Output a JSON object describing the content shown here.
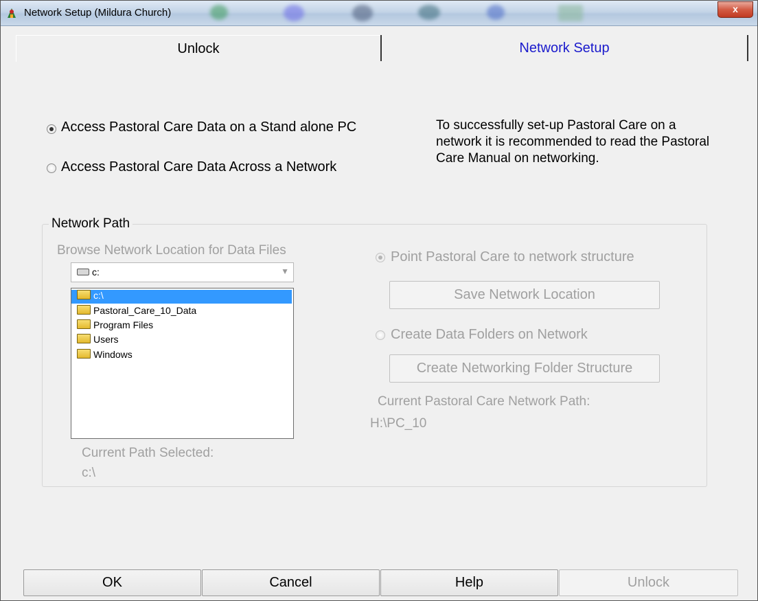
{
  "window": {
    "title": "Network Setup (Mildura Church)",
    "close_label": "x"
  },
  "tabs": [
    {
      "label": "Unlock"
    },
    {
      "label": "Network Setup"
    }
  ],
  "access_options": {
    "standalone_label": "Access Pastoral Care Data on a Stand alone PC",
    "network_label": "Access Pastoral Care Data Across a Network",
    "selected": "standalone"
  },
  "info_text": "To successfully set-up Pastoral Care on a network it is recommended to read the Pastoral Care Manual on networking.",
  "network_path": {
    "legend": "Network Path",
    "browse_label": "Browse Network Location for Data Files",
    "drive_value": "c:",
    "folders": [
      "c:\\",
      "Pastoral_Care_10_Data",
      "Program Files",
      "Users",
      "Windows"
    ],
    "selected_folder": "c:\\",
    "current_path_label": "Current Path Selected:",
    "current_path_value": "c:\\",
    "point_option_label": "Point Pastoral Care to network structure",
    "save_button_label": "Save Network Location",
    "create_option_label": "Create Data Folders on Network",
    "create_button_label": "Create Networking Folder Structure",
    "network_path_label": "Current Pastoral Care Network Path:",
    "network_path_value": "H:\\PC_10"
  },
  "buttons": {
    "ok": "OK",
    "cancel": "Cancel",
    "help": "Help",
    "unlock": "Unlock"
  },
  "colors": {
    "active_tab_text": "#1a1acc",
    "disabled_text": "#a0a0a0",
    "selection": "#3399ff"
  }
}
